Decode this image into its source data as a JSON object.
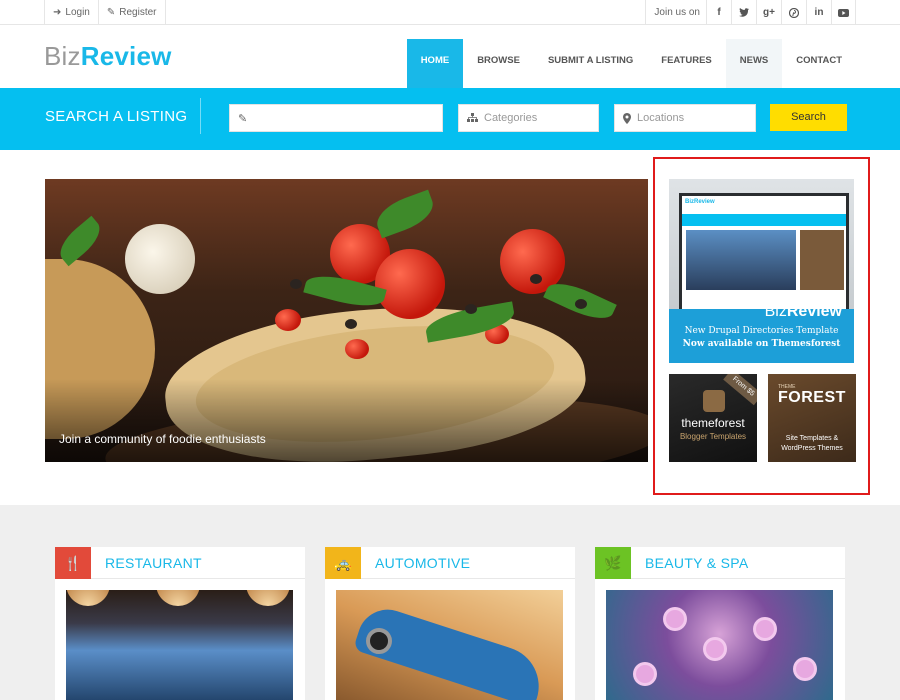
{
  "topbar": {
    "login": "Login",
    "register": "Register",
    "join_us": "Join us on",
    "social": [
      {
        "icon": "facebook-icon",
        "glyph": "f"
      },
      {
        "icon": "twitter-icon",
        "glyph": "🐦"
      },
      {
        "icon": "google-plus-icon",
        "glyph": "g+"
      },
      {
        "icon": "pinterest-icon",
        "glyph": "P"
      },
      {
        "icon": "linkedin-icon",
        "glyph": "in"
      },
      {
        "icon": "youtube-icon",
        "glyph": "▶"
      }
    ]
  },
  "logo": {
    "part1": "Biz",
    "part2": "Review"
  },
  "nav": {
    "home": "HOME",
    "browse": "BROWSE",
    "submit": "SUBMIT A LISTING",
    "features": "FEATURES",
    "news": "NEWS",
    "contact": "CONTACT"
  },
  "search": {
    "title": "SEARCH A LISTING",
    "keyword_placeholder": "",
    "categories_placeholder": "Categories",
    "locations_placeholder": "Locations",
    "button": "Search"
  },
  "hero": {
    "caption": "Join a community of foodie enthusiasts"
  },
  "ads": {
    "ad1_brand_1": "Biz",
    "ad1_brand_2": "Review",
    "ad1_line1": "New Drupal Directories Template",
    "ad1_line2": "Now available on Themesforest",
    "ad1_screen_logo": "BizReview",
    "ad2_badge": "From $5",
    "ad2_title": "themeforest",
    "ad2_sub": "Blogger Templates",
    "ad3_small": "THEME",
    "ad3_title": "FOREST",
    "ad3_sub": "Site Templates & WordPress Themes"
  },
  "categories": [
    {
      "label": "RESTAURANT",
      "icon": "fork-knife-icon",
      "glyph": "🍴"
    },
    {
      "label": "AUTOMOTIVE",
      "icon": "taxi-icon",
      "glyph": "🚕"
    },
    {
      "label": "BEAUTY & SPA",
      "icon": "leaf-icon",
      "glyph": "🌿"
    }
  ],
  "colors": {
    "accent": "#19b8e8",
    "search_band": "#05bff0",
    "search_button": "#ffdd00",
    "highlight_frame": "#e01b1b"
  }
}
